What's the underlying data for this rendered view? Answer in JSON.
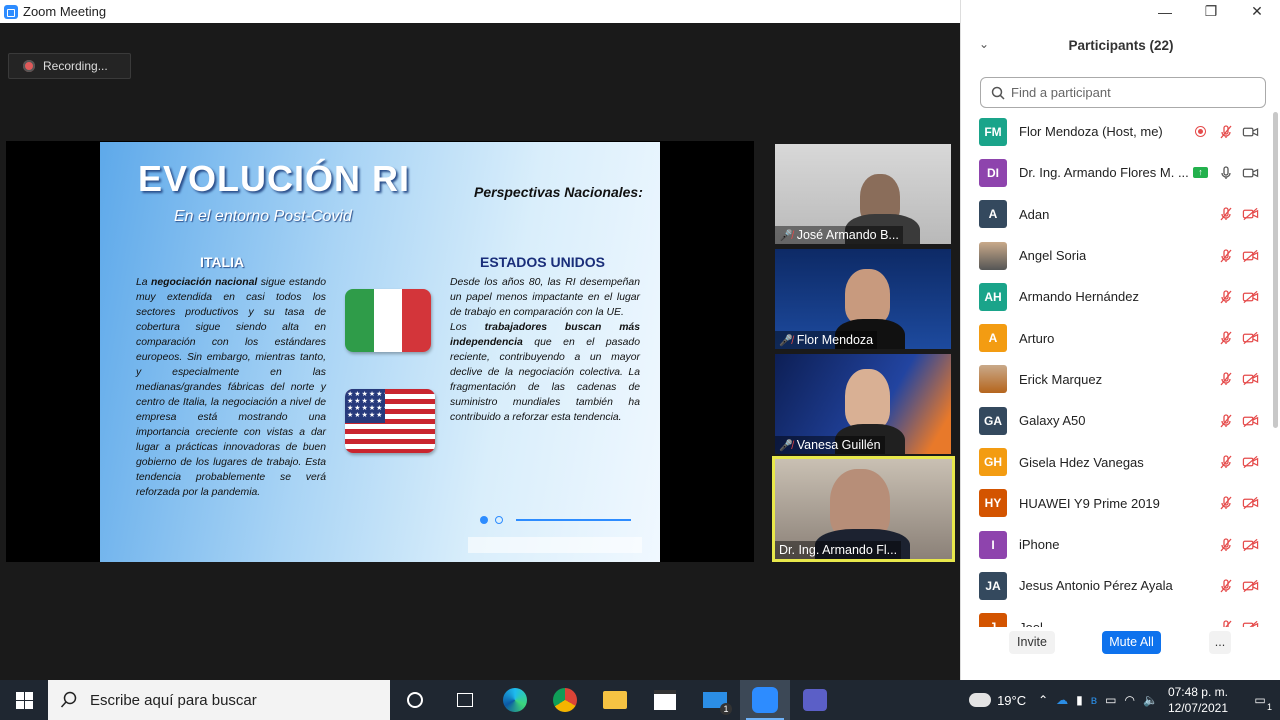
{
  "window": {
    "title": "Zoom Meeting"
  },
  "recording": {
    "label": "Recording..."
  },
  "slide": {
    "title": "EVOLUCIÓN RI",
    "subtitle": "En el entorno Post-Covid",
    "perspective": "Perspectivas Nacionales:",
    "left_heading": "ITALIA",
    "right_heading": "ESTADOS UNIDOS",
    "left_text_1": "La ",
    "left_text_bold": "negociación nacional",
    "left_text_2": " sigue estando muy extendida en casi todos los sectores productivos y su tasa de cobertura sigue siendo alta en comparación con los estándares europeos. Sin embargo, mientras tanto, y especialmente en las medianas/grandes fábricas del norte y centro de Italia, la negociación a nivel de empresa está mostrando una importancia creciente con vistas a dar lugar a prácticas innovadoras de buen gobierno de los lugares de trabajo. Esta tendencia probablemente se verá reforzada por la pandemia.",
    "right_text_1": "Desde los años 80, las RI desempeñan un papel menos impactante en el lugar de trabajo en comparación con la UE.",
    "right_text_2": "Los ",
    "right_text_bold": "trabajadores buscan más independencia",
    "right_text_3": " que en el pasado reciente, contribuyendo a un mayor declive de la negociación colectiva. La fragmentación de las cadenas de suministro mundiales también ha contribuido a reforzar esta tendencia."
  },
  "video_tiles": [
    {
      "name": "José Armando B...",
      "muted": true
    },
    {
      "name": "Flor Mendoza",
      "muted": true
    },
    {
      "name": "Vanesa Guillén",
      "muted": true
    },
    {
      "name": "Dr. Ing. Armando Fl...",
      "muted": false
    }
  ],
  "participants": {
    "header": "Participants (22)",
    "search_placeholder": "Find a participant",
    "list": [
      {
        "initials": "FM",
        "color": "#1aa48a",
        "name": "Flor Mendoza (Host, me)",
        "state": "host"
      },
      {
        "initials": "DI",
        "color": "#8e44ad",
        "name": "Dr. Ing. Armando Flores M. ...",
        "state": "sharing"
      },
      {
        "initials": "A",
        "color": "#34495e",
        "name": "Adan",
        "state": "muted"
      },
      {
        "initials": "",
        "color": "#555555",
        "name": "Angel Soria",
        "state": "muted",
        "photo": true
      },
      {
        "initials": "AH",
        "color": "#1aa48a",
        "name": "Armando Hernández",
        "state": "muted"
      },
      {
        "initials": "A",
        "color": "#f39c12",
        "name": "Arturo",
        "state": "muted"
      },
      {
        "initials": "",
        "color": "#b5651d",
        "name": "Erick Marquez",
        "state": "muted",
        "photo": true
      },
      {
        "initials": "GA",
        "color": "#34495e",
        "name": "Galaxy A50",
        "state": "muted"
      },
      {
        "initials": "GH",
        "color": "#f39c12",
        "name": "Gisela Hdez Vanegas",
        "state": "muted"
      },
      {
        "initials": "HY",
        "color": "#d35400",
        "name": "HUAWEI Y9 Prime 2019",
        "state": "muted"
      },
      {
        "initials": "I",
        "color": "#8e44ad",
        "name": "iPhone",
        "state": "muted"
      },
      {
        "initials": "JA",
        "color": "#34495e",
        "name": "Jesus Antonio Pérez Ayala",
        "state": "muted"
      },
      {
        "initials": "J",
        "color": "#d35400",
        "name": "Joel",
        "state": "muted"
      }
    ],
    "invite_label": "Invite",
    "mute_all_label": "Mute All",
    "more_label": "..."
  },
  "taskbar": {
    "search_placeholder": "Escribe aquí para buscar",
    "weather": "19°C",
    "time": "07:48 p. m.",
    "date": "12/07/2021",
    "mail_badge": "1",
    "notif_badge": "1"
  }
}
